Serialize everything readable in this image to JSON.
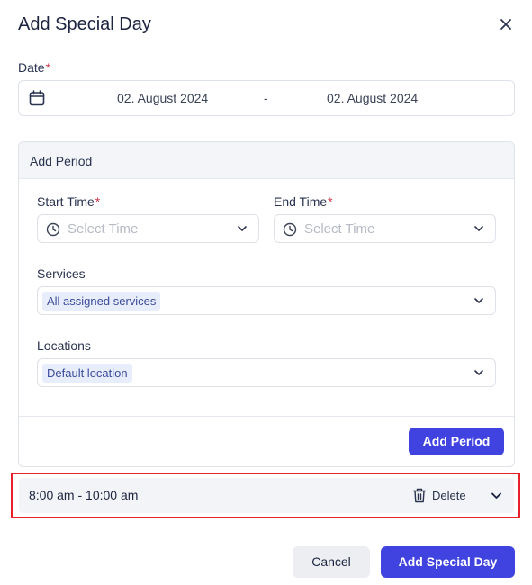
{
  "dialog": {
    "title": "Add Special Day"
  },
  "date": {
    "label": "Date",
    "required_mark": "*",
    "start": "02. August 2024",
    "separator": "-",
    "end": "02. August 2024"
  },
  "period_card": {
    "title": "Add Period",
    "start_time": {
      "label": "Start Time",
      "required_mark": "*",
      "placeholder": "Select Time"
    },
    "end_time": {
      "label": "End Time",
      "required_mark": "*",
      "placeholder": "Select Time"
    },
    "services": {
      "label": "Services",
      "selected": "All assigned services"
    },
    "locations": {
      "label": "Locations",
      "selected": "Default location"
    },
    "add_button": "Add Period"
  },
  "periods": [
    {
      "time": "8:00 am - 10:00 am",
      "delete_label": "Delete"
    }
  ],
  "footer": {
    "cancel": "Cancel",
    "submit": "Add Special Day"
  },
  "colors": {
    "accent": "#4043e0",
    "required": "#d8354a",
    "highlight": "#e8202a",
    "tag_bg": "#e8edfb"
  }
}
